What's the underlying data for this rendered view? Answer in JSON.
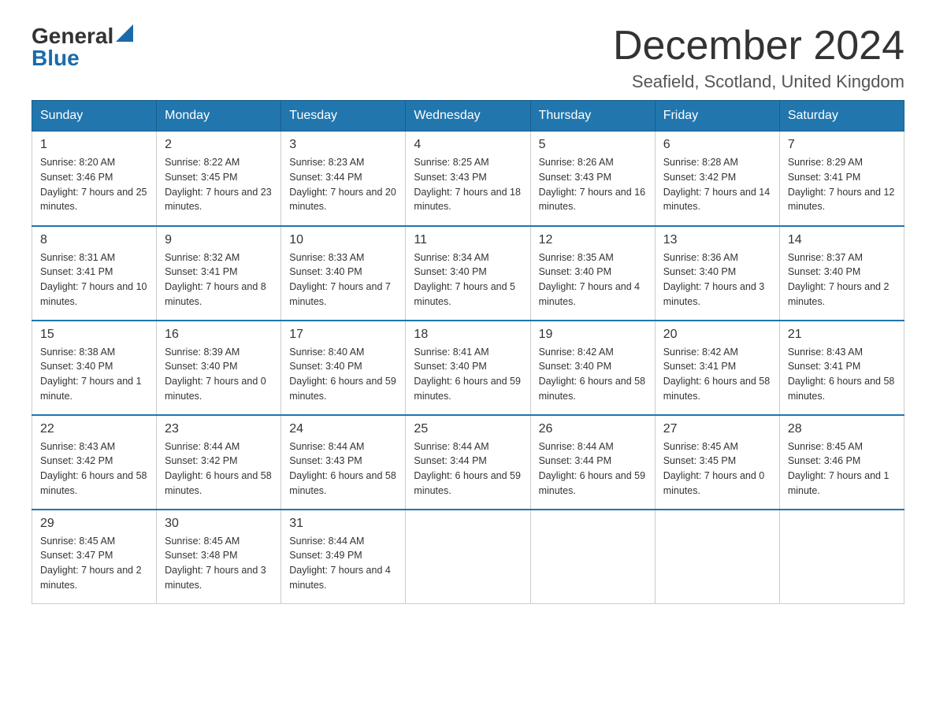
{
  "header": {
    "logo_general": "General",
    "logo_blue": "Blue",
    "month_title": "December 2024",
    "location": "Seafield, Scotland, United Kingdom"
  },
  "weekdays": [
    "Sunday",
    "Monday",
    "Tuesday",
    "Wednesday",
    "Thursday",
    "Friday",
    "Saturday"
  ],
  "weeks": [
    [
      {
        "date": "1",
        "sunrise": "8:20 AM",
        "sunset": "3:46 PM",
        "daylight": "7 hours and 25 minutes."
      },
      {
        "date": "2",
        "sunrise": "8:22 AM",
        "sunset": "3:45 PM",
        "daylight": "7 hours and 23 minutes."
      },
      {
        "date": "3",
        "sunrise": "8:23 AM",
        "sunset": "3:44 PM",
        "daylight": "7 hours and 20 minutes."
      },
      {
        "date": "4",
        "sunrise": "8:25 AM",
        "sunset": "3:43 PM",
        "daylight": "7 hours and 18 minutes."
      },
      {
        "date": "5",
        "sunrise": "8:26 AM",
        "sunset": "3:43 PM",
        "daylight": "7 hours and 16 minutes."
      },
      {
        "date": "6",
        "sunrise": "8:28 AM",
        "sunset": "3:42 PM",
        "daylight": "7 hours and 14 minutes."
      },
      {
        "date": "7",
        "sunrise": "8:29 AM",
        "sunset": "3:41 PM",
        "daylight": "7 hours and 12 minutes."
      }
    ],
    [
      {
        "date": "8",
        "sunrise": "8:31 AM",
        "sunset": "3:41 PM",
        "daylight": "7 hours and 10 minutes."
      },
      {
        "date": "9",
        "sunrise": "8:32 AM",
        "sunset": "3:41 PM",
        "daylight": "7 hours and 8 minutes."
      },
      {
        "date": "10",
        "sunrise": "8:33 AM",
        "sunset": "3:40 PM",
        "daylight": "7 hours and 7 minutes."
      },
      {
        "date": "11",
        "sunrise": "8:34 AM",
        "sunset": "3:40 PM",
        "daylight": "7 hours and 5 minutes."
      },
      {
        "date": "12",
        "sunrise": "8:35 AM",
        "sunset": "3:40 PM",
        "daylight": "7 hours and 4 minutes."
      },
      {
        "date": "13",
        "sunrise": "8:36 AM",
        "sunset": "3:40 PM",
        "daylight": "7 hours and 3 minutes."
      },
      {
        "date": "14",
        "sunrise": "8:37 AM",
        "sunset": "3:40 PM",
        "daylight": "7 hours and 2 minutes."
      }
    ],
    [
      {
        "date": "15",
        "sunrise": "8:38 AM",
        "sunset": "3:40 PM",
        "daylight": "7 hours and 1 minute."
      },
      {
        "date": "16",
        "sunrise": "8:39 AM",
        "sunset": "3:40 PM",
        "daylight": "7 hours and 0 minutes."
      },
      {
        "date": "17",
        "sunrise": "8:40 AM",
        "sunset": "3:40 PM",
        "daylight": "6 hours and 59 minutes."
      },
      {
        "date": "18",
        "sunrise": "8:41 AM",
        "sunset": "3:40 PM",
        "daylight": "6 hours and 59 minutes."
      },
      {
        "date": "19",
        "sunrise": "8:42 AM",
        "sunset": "3:40 PM",
        "daylight": "6 hours and 58 minutes."
      },
      {
        "date": "20",
        "sunrise": "8:42 AM",
        "sunset": "3:41 PM",
        "daylight": "6 hours and 58 minutes."
      },
      {
        "date": "21",
        "sunrise": "8:43 AM",
        "sunset": "3:41 PM",
        "daylight": "6 hours and 58 minutes."
      }
    ],
    [
      {
        "date": "22",
        "sunrise": "8:43 AM",
        "sunset": "3:42 PM",
        "daylight": "6 hours and 58 minutes."
      },
      {
        "date": "23",
        "sunrise": "8:44 AM",
        "sunset": "3:42 PM",
        "daylight": "6 hours and 58 minutes."
      },
      {
        "date": "24",
        "sunrise": "8:44 AM",
        "sunset": "3:43 PM",
        "daylight": "6 hours and 58 minutes."
      },
      {
        "date": "25",
        "sunrise": "8:44 AM",
        "sunset": "3:44 PM",
        "daylight": "6 hours and 59 minutes."
      },
      {
        "date": "26",
        "sunrise": "8:44 AM",
        "sunset": "3:44 PM",
        "daylight": "6 hours and 59 minutes."
      },
      {
        "date": "27",
        "sunrise": "8:45 AM",
        "sunset": "3:45 PM",
        "daylight": "7 hours and 0 minutes."
      },
      {
        "date": "28",
        "sunrise": "8:45 AM",
        "sunset": "3:46 PM",
        "daylight": "7 hours and 1 minute."
      }
    ],
    [
      {
        "date": "29",
        "sunrise": "8:45 AM",
        "sunset": "3:47 PM",
        "daylight": "7 hours and 2 minutes."
      },
      {
        "date": "30",
        "sunrise": "8:45 AM",
        "sunset": "3:48 PM",
        "daylight": "7 hours and 3 minutes."
      },
      {
        "date": "31",
        "sunrise": "8:44 AM",
        "sunset": "3:49 PM",
        "daylight": "7 hours and 4 minutes."
      },
      null,
      null,
      null,
      null
    ]
  ]
}
